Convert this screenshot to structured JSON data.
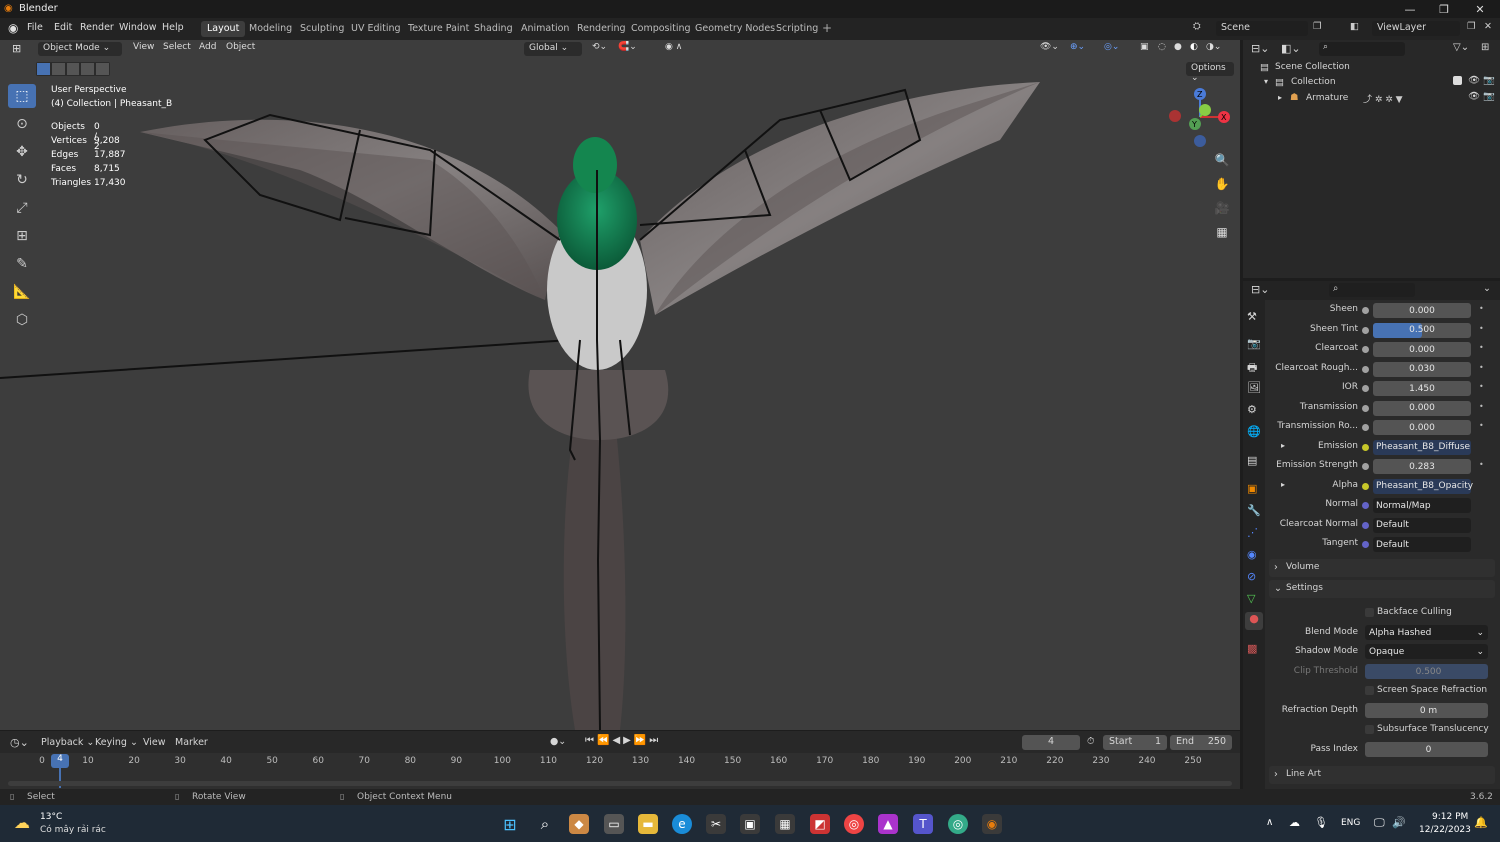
{
  "app": {
    "title": "Blender"
  },
  "menu": [
    "File",
    "Edit",
    "Render",
    "Window",
    "Help"
  ],
  "workspaces": [
    "Layout",
    "Modeling",
    "Sculpting",
    "UV Editing",
    "Texture Paint",
    "Shading",
    "Animation",
    "Rendering",
    "Compositing",
    "Geometry Nodes",
    "Scripting"
  ],
  "scene": {
    "name": "Scene",
    "view_layer": "ViewLayer"
  },
  "viewport": {
    "mode": "Object Mode",
    "menus": [
      "View",
      "Select",
      "Add",
      "Object"
    ],
    "transform": "Global",
    "options": "Options",
    "perspective": "User Perspective",
    "collection_path": "(4) Collection | Pheasant_B",
    "stats": [
      {
        "label": "Objects",
        "value": "0 / 2"
      },
      {
        "label": "Vertices",
        "value": "9,208"
      },
      {
        "label": "Edges",
        "value": "17,887"
      },
      {
        "label": "Faces",
        "value": "8,715"
      },
      {
        "label": "Triangles",
        "value": "17,430"
      }
    ],
    "gizmo": {
      "x": "X",
      "y": "Y",
      "z": "Z"
    }
  },
  "outliner": {
    "root": "Scene Collection",
    "collection": "Collection",
    "armature": "Armature"
  },
  "properties": {
    "rows": [
      {
        "label": "Sheen",
        "value": "0.000",
        "type": "num"
      },
      {
        "label": "Sheen Tint",
        "value": "0.500",
        "type": "bar"
      },
      {
        "label": "Clearcoat",
        "value": "0.000",
        "type": "num"
      },
      {
        "label": "Clearcoat Rough...",
        "value": "0.030",
        "type": "num"
      },
      {
        "label": "IOR",
        "value": "1.450",
        "type": "num"
      },
      {
        "label": "Transmission",
        "value": "0.000",
        "type": "num"
      },
      {
        "label": "Transmission Ro...",
        "value": "0.000",
        "type": "num"
      },
      {
        "label": "Emission",
        "value": "Pheasant_B8_Diffuse",
        "type": "link"
      },
      {
        "label": "Emission Strength",
        "value": "0.283",
        "type": "num"
      },
      {
        "label": "Alpha",
        "value": "Pheasant_B8_Opacity",
        "type": "link"
      },
      {
        "label": "Normal",
        "value": "Normal/Map",
        "type": "dark"
      },
      {
        "label": "Clearcoat Normal",
        "value": "Default",
        "type": "dark"
      },
      {
        "label": "Tangent",
        "value": "Default",
        "type": "dark"
      }
    ],
    "sheen_tint_fill": 0.5,
    "sections": {
      "volume": "Volume",
      "settings": "Settings",
      "line_art": "Line Art"
    },
    "settings": {
      "backface_culling": "Backface Culling",
      "blend_mode_label": "Blend Mode",
      "blend_mode": "Alpha Hashed",
      "shadow_mode_label": "Shadow Mode",
      "shadow_mode": "Opaque",
      "clip_threshold_label": "Clip Threshold",
      "clip_threshold": "0.500",
      "ssr": "Screen Space Refraction",
      "refraction_depth_label": "Refraction Depth",
      "refraction_depth": "0 m",
      "subsurface": "Subsurface Translucency",
      "pass_index_label": "Pass Index",
      "pass_index": "0"
    }
  },
  "timeline": {
    "menus": [
      "Playback",
      "Keying",
      "View",
      "Marker"
    ],
    "current_frame": "4",
    "start_label": "Start",
    "start": "1",
    "end_label": "End",
    "end": "250",
    "ticks": [
      "0",
      "10",
      "20",
      "30",
      "40",
      "50",
      "60",
      "70",
      "80",
      "90",
      "100",
      "110",
      "120",
      "130",
      "140",
      "150",
      "160",
      "170",
      "180",
      "190",
      "200",
      "210",
      "220",
      "230",
      "240",
      "250"
    ]
  },
  "statusbar": {
    "select": "Select",
    "rotate": "Rotate View",
    "context": "Object Context Menu",
    "version": "3.6.2"
  },
  "taskbar": {
    "temp": "13°C",
    "weather": "Có mây rải rác",
    "lang": "ENG",
    "time": "9:12 PM",
    "date": "12/22/2023"
  },
  "colors": {
    "accent": "#4772b3",
    "header": "#232323",
    "viewport": "#3d3d3d",
    "panel": "#2a2a2a"
  }
}
